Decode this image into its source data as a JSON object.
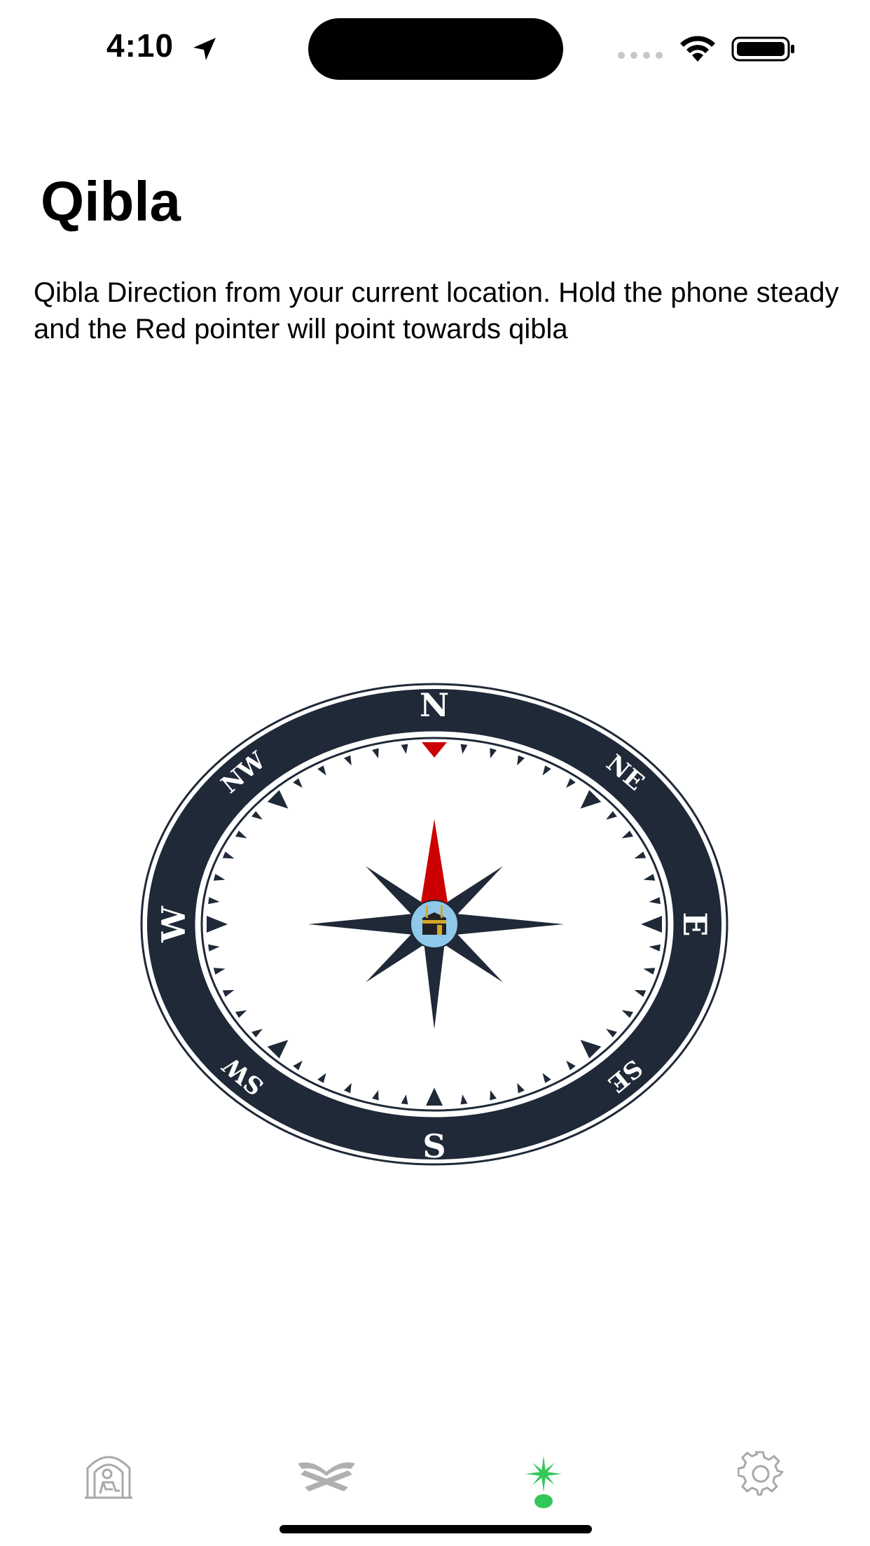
{
  "status_bar": {
    "time": "4:10",
    "icons": [
      "location-arrow-icon",
      "cellular-signal-icon",
      "wifi-icon",
      "battery-icon"
    ]
  },
  "page": {
    "title": "Qibla",
    "description": "Qibla Direction from your current location. Hold the phone steady and the Red pointer will point towards qibla"
  },
  "compass": {
    "directions": {
      "n": "N",
      "ne": "NE",
      "e": "E",
      "se": "SE",
      "s": "S",
      "sw": "SW",
      "w": "W",
      "nw": "NW"
    },
    "colors": {
      "ring": "#1f2937",
      "pointer": "#cc0000",
      "star": "#1f2937"
    },
    "center_icon": "kaaba-icon"
  },
  "tab_bar": {
    "tabs": [
      {
        "icon": "prayer-mosque-icon",
        "active": false
      },
      {
        "icon": "quran-stand-icon",
        "active": false
      },
      {
        "icon": "qibla-compass-icon",
        "active": true
      },
      {
        "icon": "settings-gear-icon",
        "active": false
      }
    ],
    "active_color": "#34c759",
    "inactive_color": "#a8a8a8"
  }
}
